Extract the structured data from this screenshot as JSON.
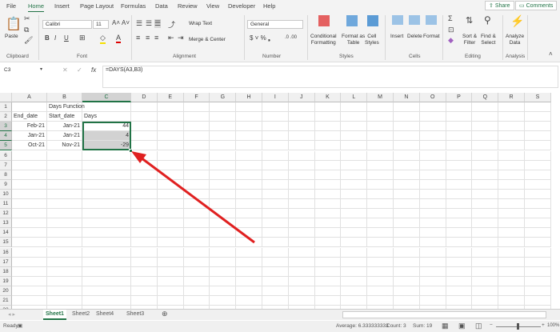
{
  "menu_tabs": [
    "File",
    "Home",
    "Insert",
    "Page Layout",
    "Formulas",
    "Data",
    "Review",
    "View",
    "Developer",
    "Help"
  ],
  "active_tab": "Home",
  "share_label": "Share",
  "comments_label": "Comments",
  "ribbon": {
    "paste": "Paste",
    "font_name": "Calibri",
    "font_size": "11",
    "wrap_text": "Wrap Text",
    "merge_center": "Merge & Center",
    "number_format": "General",
    "conditional": "Conditional",
    "formatting": "Formatting",
    "format_as": "Format as",
    "table": "Table",
    "cell": "Cell",
    "styles_btn": "Styles",
    "insert": "Insert",
    "delete": "Delete",
    "format": "Format",
    "sort": "Sort &",
    "filter": "Filter",
    "find": "Find &",
    "select": "Select",
    "analyze": "Analyze",
    "data": "Data",
    "groups": [
      "Clipboard",
      "Font",
      "Alignment",
      "Number",
      "Styles",
      "Cells",
      "Editing",
      "Analysis"
    ]
  },
  "name_box": "C3",
  "formula": "=DAYS(A3,B3)",
  "fx": "fx",
  "columns": [
    "A",
    "B",
    "C",
    "D",
    "E",
    "F",
    "G",
    "H",
    "I",
    "J",
    "K",
    "L",
    "M",
    "N",
    "O",
    "P",
    "Q",
    "R",
    "S"
  ],
  "row_count": 22,
  "cells": {
    "B1": {
      "v": "Days Function",
      "align": "left"
    },
    "A2": {
      "v": "End_date"
    },
    "B2": {
      "v": "Start_date"
    },
    "C2": {
      "v": "Days"
    },
    "A3": {
      "v": "Feb-21",
      "align": "right"
    },
    "B3": {
      "v": "Jan-21",
      "align": "right"
    },
    "C3": {
      "v": "44",
      "align": "right"
    },
    "A4": {
      "v": "Jan-21",
      "align": "right"
    },
    "B4": {
      "v": "Jan-21",
      "align": "right"
    },
    "C4": {
      "v": "4",
      "align": "right"
    },
    "A5": {
      "v": "Oct-21",
      "align": "right"
    },
    "B5": {
      "v": "Nov-21",
      "align": "right"
    },
    "C5": {
      "v": "-29",
      "align": "right"
    }
  },
  "sheets": [
    "Sheet1",
    "Sheet2",
    "Sheet4",
    "Sheet3"
  ],
  "active_sheet": "Sheet1",
  "status": {
    "ready": "Ready",
    "average": "Average: 6.333333333",
    "count": "Count: 3",
    "sum": "Sum: 19",
    "zoom": "100%"
  },
  "colors": {
    "accent": "#217346",
    "arrow": "#e02020"
  }
}
